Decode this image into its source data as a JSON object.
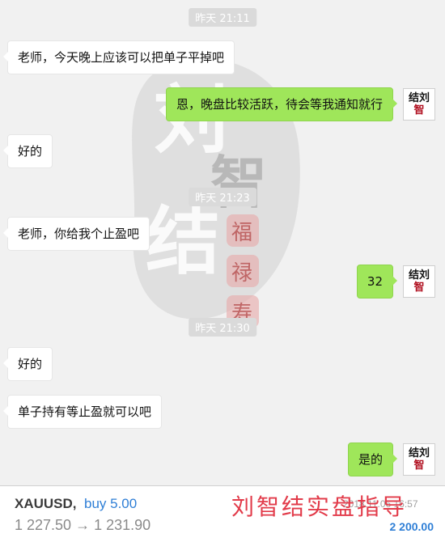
{
  "watermark": {
    "big_chars": [
      "刘",
      "智",
      "结"
    ],
    "seal_chars": [
      "福",
      "禄",
      "寿"
    ]
  },
  "messages": [
    {
      "type": "time",
      "text": "昨天 21:11"
    },
    {
      "type": "left",
      "text": "老师，今天晚上应该可以把单子平掉吧"
    },
    {
      "type": "right",
      "text": "恩，晚盘比较活跃，待会等我通知就行"
    },
    {
      "type": "left",
      "text": "好的"
    },
    {
      "type": "time",
      "text": "昨天 21:23"
    },
    {
      "type": "left",
      "text": "老师，你给我个止盈吧"
    },
    {
      "type": "right",
      "text": "32"
    },
    {
      "type": "time",
      "text": "昨天 21:30"
    },
    {
      "type": "left",
      "text": "好的"
    },
    {
      "type": "left",
      "text": "单子持有等止盈就可以吧"
    },
    {
      "type": "right",
      "text": "是的"
    }
  ],
  "avatar": {
    "line1": "结刘",
    "line2": "智"
  },
  "trade": {
    "symbol": "XAUUSD,",
    "side": "buy 5.00",
    "prices": "1 227.50 → 1 231.90",
    "datetime": "2018.11.06 16:57",
    "profit": "2 200.00",
    "caption": "刘智结实盘指导"
  },
  "colors": {
    "bubble_right": "#9fe65a",
    "bubble_left": "#ffffff",
    "chat_background": "#f1f1f1",
    "trade_blue": "#2f7fd6",
    "caption_red": "#e23b4a"
  }
}
